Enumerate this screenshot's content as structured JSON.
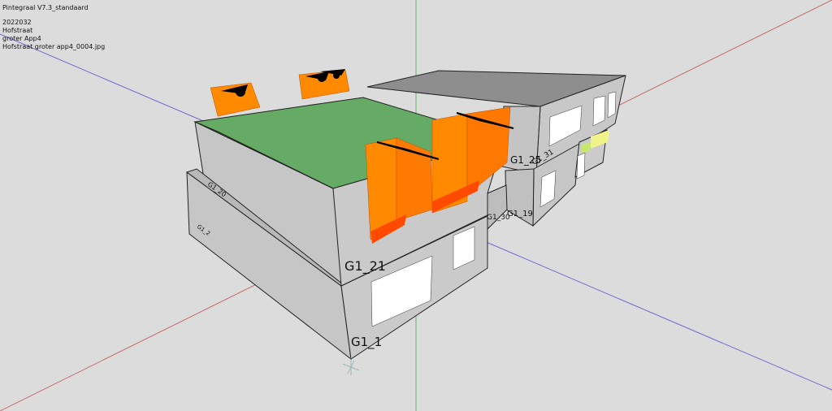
{
  "header": {
    "app_title": "Pintegraal V7.3_standaard",
    "project_number": "2022032",
    "street": "Hofstraat",
    "project_name": "groter App4",
    "image_file": "Hofstraat groter app4_0004.jpg"
  },
  "scene": {
    "zone_labels": {
      "g1_1": "G1_1",
      "g1_21": "G1_21",
      "g1_25": "G1_25",
      "g1_31": "G1_31",
      "g1_30": "G1_30",
      "g1_19": "G1_19",
      "g1_20": "G1_20",
      "g1_2": "G1_2"
    },
    "colors": {
      "background": "#dcdcdc",
      "wall": "#c8c8c8",
      "roof_green": "#66aa66",
      "window": "#ffffff",
      "dormer_orange": "#ff8a00",
      "dormer_red": "#ff4a00",
      "axis_x": "#c86464",
      "axis_y": "#6464d2",
      "axis_z": "#64b464"
    }
  }
}
